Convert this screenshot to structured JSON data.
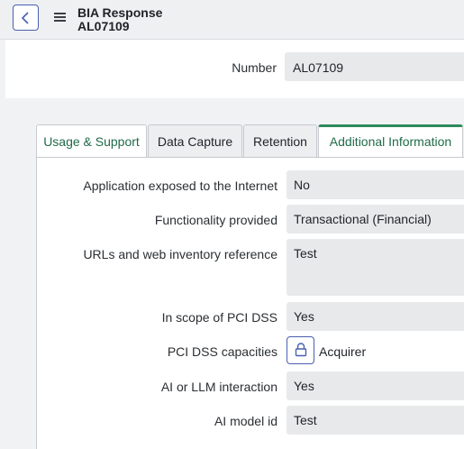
{
  "header": {
    "title": "BIA Response",
    "subtitle": "AL07109"
  },
  "number": {
    "label": "Number",
    "value": "AL07109"
  },
  "tabs": [
    {
      "label": "Usage & Support"
    },
    {
      "label": "Data Capture"
    },
    {
      "label": "Retention"
    },
    {
      "label": "Additional Information"
    }
  ],
  "fields": {
    "internet": {
      "label": "Application exposed to the Internet",
      "value": "No"
    },
    "functionality": {
      "label": "Functionality provided",
      "value": "Transactional (Financial)"
    },
    "urls": {
      "label": "URLs and web inventory reference",
      "value": "Test"
    },
    "pci_scope": {
      "label": "In scope of PCI DSS",
      "value": "Yes"
    },
    "pci_capacities": {
      "label": "PCI DSS capacities",
      "value": "Acquirer"
    },
    "ai_llm": {
      "label": "AI or LLM interaction",
      "value": "Yes"
    },
    "ai_model": {
      "label": "AI model id",
      "value": "Test"
    }
  },
  "icons": {
    "back": "chevron-left-icon",
    "menu": "hamburger-menu-icon",
    "lock": "lock-icon"
  },
  "colors": {
    "accent_blue": "#4a5fb0",
    "active_tab_green": "#2e8a5c",
    "field_bg": "#e8e9eb"
  }
}
